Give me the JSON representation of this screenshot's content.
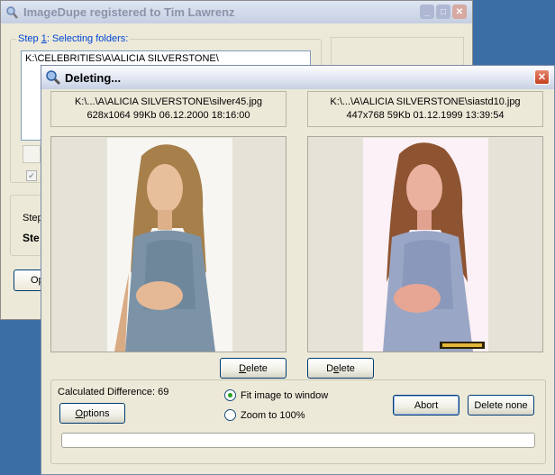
{
  "main_window": {
    "title": "ImageDupe registered to Tim Lawrenz",
    "step1_prefix": "Step ",
    "step1_num": "1",
    "step1_rest": ": Selecting folders:",
    "folders": [
      "K:\\CELEBRITIES\\A\\ALICIA SILVERSTONE\\"
    ],
    "step_label_partial": "Step",
    "step_bold_partial": "Ste",
    "options_partial": "Op",
    "checkbox_checked": true
  },
  "dialog": {
    "title": "Deleting...",
    "left": {
      "path": "K:\\...\\A\\ALICIA SILVERSTONE\\silver45.jpg",
      "details": "628x1064  99Kb  06.12.2000 18:16:00",
      "delete_label": "Delete",
      "delete_mnemonic": "D"
    },
    "right": {
      "path": "K:\\...\\A\\ALICIA SILVERSTONE\\siastd10.jpg",
      "details": "447x768  59Kb  01.12.1999 13:39:54",
      "delete_label": "Delete",
      "delete_mnemonic": "e"
    },
    "calculated_difference_label": "Calculated Difference: 69",
    "options_label": "Options",
    "fit_label": "Fit image to window",
    "zoom_label": "Zoom to 100%",
    "selected_view": "fit",
    "abort_label": "Abort",
    "delete_none_label": "Delete none",
    "progress": 0
  },
  "colors": {
    "desktop": "#3a6ea5",
    "window_face": "#ece9d8",
    "accent_label": "#0046d5",
    "progress_fill": "#2fb52f"
  }
}
